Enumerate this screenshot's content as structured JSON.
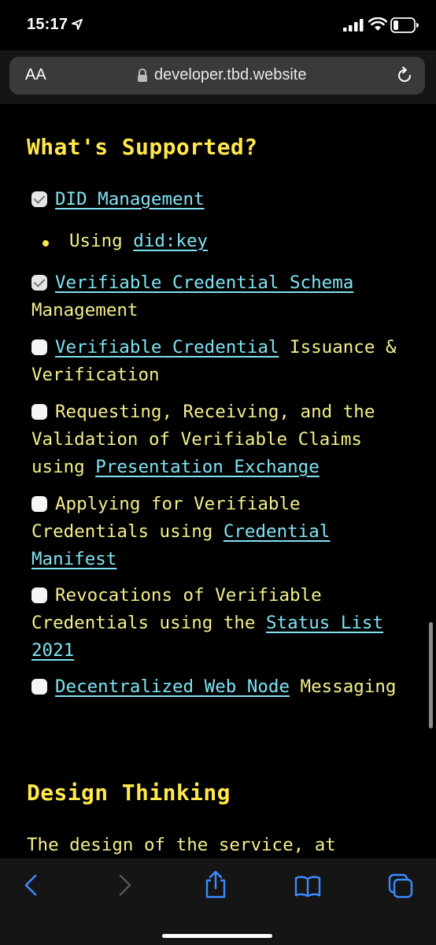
{
  "status": {
    "time": "15:17"
  },
  "browser": {
    "aa_label": "AA",
    "domain": "developer.tbd.website"
  },
  "content": {
    "heading": "What's Supported?",
    "items": [
      {
        "checked": true,
        "link": "DID Management"
      },
      {
        "sub": "Using ",
        "link": "did:key"
      },
      {
        "checked": true,
        "link": "Verifiable Credential Schema",
        "after": " Management"
      },
      {
        "checked": false,
        "link": "Verifiable Credential",
        "after": " Issuance & Verification"
      },
      {
        "checked": false,
        "pre": "Requesting, Receiving, and the Validation of Verifiable Claims using ",
        "link": "Presentation Exchange"
      },
      {
        "checked": false,
        "pre": "Applying for Verifiable Credentials using ",
        "link": "Credential Manifest"
      },
      {
        "checked": false,
        "pre": "Revocations of Verifiable Credentials using the ",
        "link": "Status List 2021"
      },
      {
        "checked": false,
        "link": "Decentralized Web Node",
        "after": " Messaging"
      }
    ],
    "heading2": "Design Thinking",
    "para": "The design of the service, at"
  }
}
